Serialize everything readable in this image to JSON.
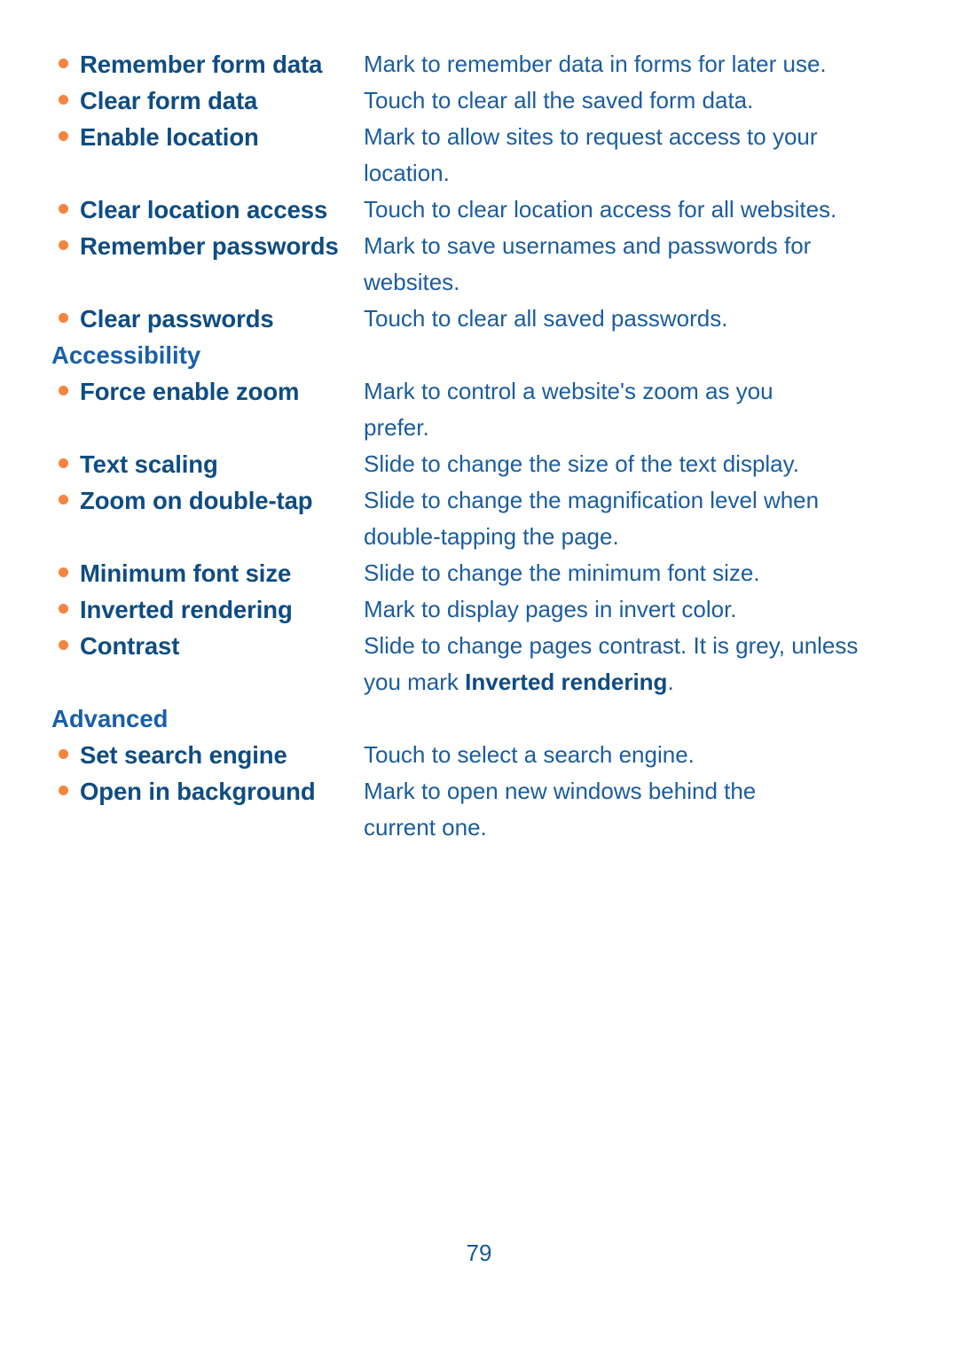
{
  "colors": {
    "bullet": "#F5843C",
    "term": "#0F4C81",
    "description": "#1B5C9E",
    "heading": "#1A5FA8",
    "page_number": "#12599C",
    "background": "#FFFFFF"
  },
  "page_number": "79",
  "blocks": [
    {
      "kind": "entry",
      "term": "Remember form data",
      "description": "Mark to remember data in forms for later use.",
      "description_lines": [
        "Mark to remember data in forms for later use."
      ]
    },
    {
      "kind": "entry",
      "term": "Clear form data",
      "description": "Touch to clear all the saved form data.",
      "description_lines": [
        "Touch to clear all the saved form data."
      ]
    },
    {
      "kind": "entry",
      "term": "Enable location",
      "description": "Mark to allow sites to request access to your location.",
      "description_lines": [
        "Mark to allow sites to request access to your",
        "location."
      ]
    },
    {
      "kind": "entry",
      "term": "Clear location access",
      "description": "Touch to clear location access for all websites.",
      "description_lines": [
        "Touch to clear location access for all websites."
      ]
    },
    {
      "kind": "entry",
      "term": "Remember passwords",
      "description": "Mark to save usernames and passwords for websites.",
      "description_lines": [
        "Mark to save usernames and passwords for",
        "websites."
      ]
    },
    {
      "kind": "entry",
      "term": "Clear passwords",
      "description": "Touch to clear all saved passwords.",
      "description_lines": [
        "Touch to clear all saved passwords."
      ]
    },
    {
      "kind": "heading",
      "heading": "Accessibility"
    },
    {
      "kind": "entry",
      "term": "Force enable zoom",
      "description": "Mark to control a website's zoom as you prefer.",
      "description_lines": [
        "Mark to control a website's zoom as you",
        "prefer."
      ]
    },
    {
      "kind": "entry",
      "term": "Text scaling",
      "description": "Slide to change the size of the text display.",
      "description_lines": [
        "Slide to change the size of the text display."
      ]
    },
    {
      "kind": "entry",
      "term": "Zoom on double-tap",
      "description": "Slide to change the magnification level when double-tapping the page.",
      "description_lines": [
        "Slide to change the magnification level when",
        "double-tapping the page."
      ]
    },
    {
      "kind": "entry",
      "term": "Minimum font size",
      "description": "Slide to change the minimum font size.",
      "description_lines": [
        "Slide to change the minimum font size."
      ]
    },
    {
      "kind": "entry",
      "term": "Inverted rendering",
      "description": "Mark to display pages in invert color.",
      "description_lines": [
        "Mark to display pages in invert color."
      ]
    },
    {
      "kind": "entry",
      "term": "Contrast",
      "description": "Slide to change pages contrast. It is grey, unless you mark Inverted rendering.",
      "description_lines": [
        "Slide to change pages contrast. It is grey, unless",
        "you mark Inverted rendering."
      ],
      "description_bold_phrase": "Inverted rendering"
    },
    {
      "kind": "heading",
      "heading": "Advanced"
    },
    {
      "kind": "entry",
      "term": "Set search engine",
      "description": "Touch to select a search engine.",
      "description_lines": [
        "Touch to select a search engine."
      ]
    },
    {
      "kind": "entry",
      "term": "Open in background",
      "description": "Mark to open new windows behind the current one.",
      "description_lines": [
        "Mark to open new windows behind the",
        "current one."
      ]
    }
  ]
}
